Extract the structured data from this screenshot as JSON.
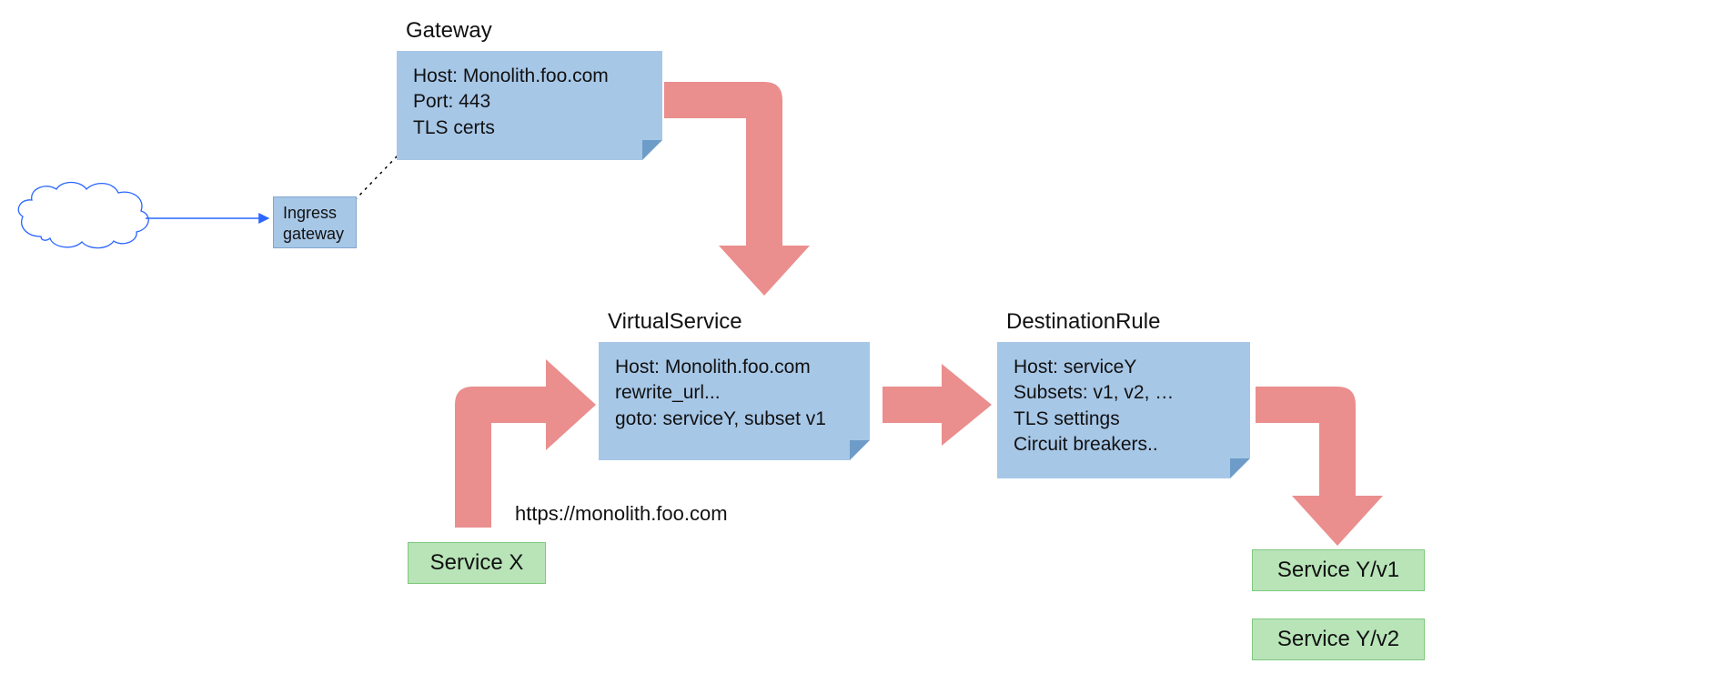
{
  "cloud": {
    "label": ""
  },
  "ingress_gateway": {
    "line1": "Ingress",
    "line2": "gateway"
  },
  "gateway": {
    "title": "Gateway",
    "line1": "Host: Monolith.foo.com",
    "line2": "Port: 443",
    "line3": "TLS certs"
  },
  "virtual_service": {
    "title": "VirtualService",
    "line1": "Host: Monolith.foo.com",
    "line2": "rewrite_url...",
    "line3": "goto: serviceY, subset v1"
  },
  "destination_rule": {
    "title": "DestinationRule",
    "line1": "Host: serviceY",
    "line2": "Subsets: v1, v2, …",
    "line3": "TLS settings",
    "line4": "Circuit breakers.."
  },
  "service_x": {
    "label": "Service X",
    "url": "https://monolith.foo.com"
  },
  "service_y_v1": {
    "label": "Service Y/v1"
  },
  "service_y_v2": {
    "label": "Service Y/v2"
  },
  "colors": {
    "note_bg": "#a7c7e7",
    "arrow": "#ea8e8e",
    "svc_bg": "#b8e4b8",
    "cloud_stroke": "#2a66ff"
  }
}
